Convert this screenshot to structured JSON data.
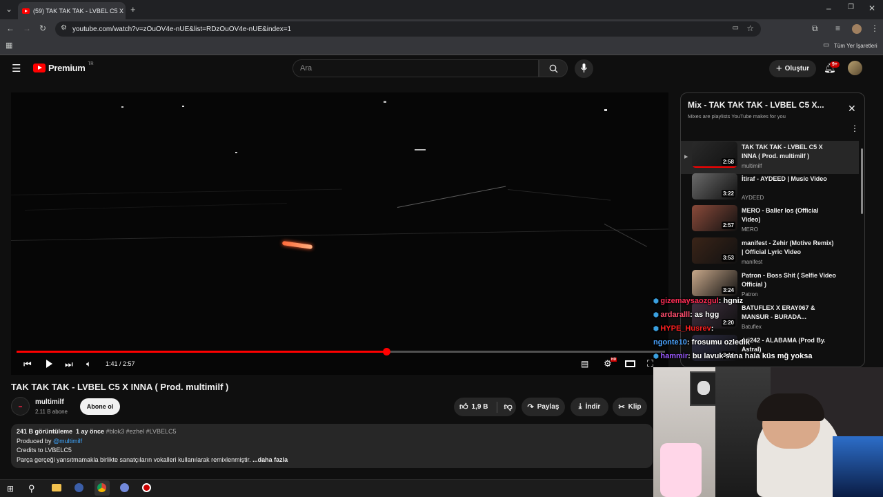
{
  "browser": {
    "tab_title": "(59) TAK TAK TAK - LVBEL C5 X IN",
    "url": "youtube.com/watch?v=zOuOV4e-nUE&list=RDzOuOV4e-nUE&index=1",
    "bookmarks_label": "Tüm Yer İşaretleri"
  },
  "header": {
    "logo": "Premium",
    "logo_badge": "TR",
    "search_placeholder": "Ara",
    "create_label": "Oluştur",
    "notif_count": "9+"
  },
  "player": {
    "time": "1:41 / 2:57",
    "progress_fraction": 0.57,
    "hd_badge": "HD"
  },
  "video": {
    "title": "TAK TAK TAK - LVBEL C5 X INNA ( Prod. multimilf )",
    "channel": "multimilf",
    "subscribers": "2,11 B abone",
    "subscribe_label": "Abone ol",
    "likes": "1,9 B",
    "share_label": "Paylaş",
    "download_label": "İndir",
    "clip_label": "Klip"
  },
  "description": {
    "meta": "241 B görüntüleme  1 ay önce",
    "hashtags": "#blok3 #ezhel #LVBELC5",
    "line1_prefix": "Produced by ",
    "line1_link": "@multimilf",
    "line2": "Credits to LVBELC5",
    "line3": "Parça gerçeği yansıtmamakla birlikte sanatçıların vokalleri kullanılarak remixlenmiştir.",
    "more": "...daha fazla"
  },
  "playlist": {
    "title": "Mix - TAK TAK TAK - LVBEL C5 X...",
    "subtitle": "Mixes are playlists YouTube makes for you",
    "items": [
      {
        "title": "TAK TAK TAK - LVBEL C5 X INNA ( Prod. multimilf )",
        "channel": "multimilf",
        "duration": "2:58"
      },
      {
        "title": "İtiraf - AYDEED | Music Video",
        "channel": "AYDEED",
        "duration": "3:22"
      },
      {
        "title": "MERO - Baller los (Official Video)",
        "channel": "MERO",
        "duration": "2:57"
      },
      {
        "title": "manifest - Zehir (Motive Remix) | Official Lyric Video",
        "channel": "manifest",
        "duration": "3:53"
      },
      {
        "title": "Patron - Boss Shit ( Selfie Video Official )",
        "channel": "Patron",
        "duration": "3:24"
      },
      {
        "title": "BATUFLEX X ERAY067 & MANSUR - BURADA...",
        "channel": "Batuflex",
        "duration": "2:20"
      },
      {
        "title": "Ati242 - ALABAMA (Prod By. Astral)",
        "channel": "",
        "duration": "3:14"
      }
    ]
  },
  "chat": [
    {
      "user": "gizemaysaozgul",
      "msg": ": hgniz",
      "color": "#ff2d55"
    },
    {
      "user": "ardaralll",
      "msg": ": as hgg",
      "color": "#ff4d6d"
    },
    {
      "user": "HYPE_Husrev",
      "msg": ":",
      "color": "#ff2020"
    },
    {
      "user": "ngonte10",
      "msg": ": frosumu ozledik",
      "color": "#4aa3ff"
    },
    {
      "user": "hammir",
      "msg": ": bu lavuk sana hala küs mğ yoksa",
      "color": "#9b59ff"
    }
  ]
}
